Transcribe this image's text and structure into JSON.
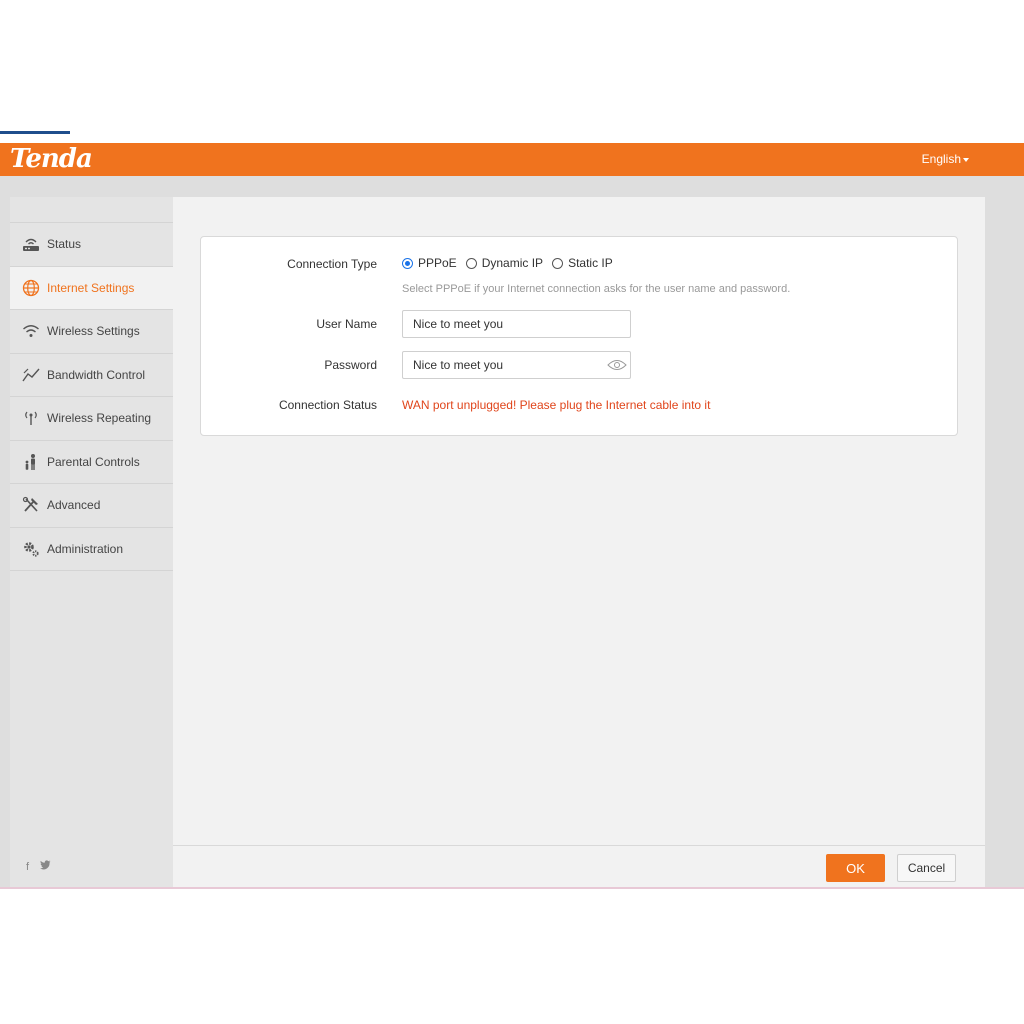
{
  "header": {
    "logo": "Tenda",
    "language": "English",
    "accent_color": "#f0731e"
  },
  "sidebar": {
    "items": [
      {
        "label": "Status",
        "icon": "router-icon",
        "active": false
      },
      {
        "label": "Internet Settings",
        "icon": "globe-icon",
        "active": true
      },
      {
        "label": "Wireless Settings",
        "icon": "wifi-icon",
        "active": false
      },
      {
        "label": "Bandwidth Control",
        "icon": "bandwidth-chart-icon",
        "active": false
      },
      {
        "label": "Wireless Repeating",
        "icon": "antenna-icon",
        "active": false
      },
      {
        "label": "Parental Controls",
        "icon": "parent-child-icon",
        "active": false
      },
      {
        "label": "Advanced",
        "icon": "tools-icon",
        "active": false
      },
      {
        "label": "Administration",
        "icon": "gears-icon",
        "active": false
      }
    ],
    "social": {
      "facebook": "f",
      "twitter": "twitter-icon"
    }
  },
  "form": {
    "connection_type_label": "Connection Type",
    "options": [
      "PPPoE",
      "Dynamic IP",
      "Static IP"
    ],
    "selected": "PPPoE",
    "hint": "Select PPPoE if your Internet connection asks for the user name and password.",
    "username_label": "User Name",
    "username_value": "Nice to meet you",
    "password_label": "Password",
    "password_value": "Nice to meet you",
    "status_label": "Connection Status",
    "status_text": "WAN port unplugged! Please plug the Internet cable into it",
    "status_color": "#e0451b"
  },
  "footer": {
    "ok_label": "OK",
    "cancel_label": "Cancel"
  }
}
